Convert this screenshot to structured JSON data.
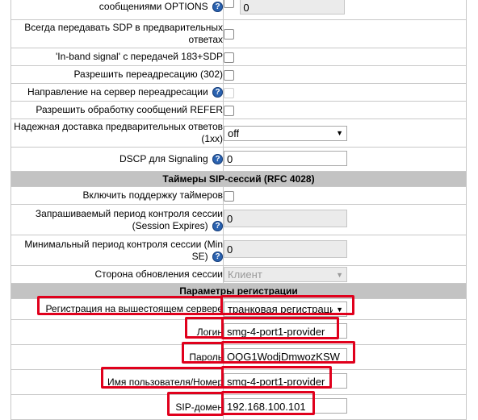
{
  "rows": {
    "options_label": "сообщениями OPTIONS",
    "options_value": "0",
    "sdp_label": "Всегда передавать SDP в предварительных ответах",
    "inband_label": "'In-band signal' с передачей 183+SDP",
    "redirect302_label": "Разрешить переадресацию (302)",
    "redirect_dir_label": "Направление на сервер переадресации",
    "refer_label": "Разрешить обработку сообщений REFER",
    "reliable_label": "Надежная доставка предварительных ответов (1xx)",
    "reliable_value": "off",
    "dscp_label": "DSCP для Signaling",
    "dscp_value": "0"
  },
  "timers": {
    "title": "Таймеры SIP-сессий (RFC 4028)",
    "enable_label": "Включить поддержку таймеров",
    "expires_label": "Запрашиваемый период контроля сессии (Session Expires)",
    "expires_value": "0",
    "min_label": "Минимальный период контроля сессии (Min SE)",
    "min_value": "0",
    "refresher_label": "Сторона обновления сессии",
    "refresher_value": "Клиент"
  },
  "registration": {
    "title": "Параметры регистрации",
    "upstream_label": "Регистрация на вышестоящем сервере",
    "upstream_value": "транковая регистраци",
    "login_label": "Логин",
    "login_value": "smg-4-port1-provider",
    "password_label": "Пароль",
    "password_value": "OQG1WodjDmwozKSW",
    "username_label": "Имя пользователя/Номер",
    "username_value": "smg-4-port1-provider",
    "domain_label": "SIP-домен",
    "domain_value": "192.168.100.101"
  },
  "icons": {
    "help": "help-icon",
    "dropdown": "chevron-down-icon"
  },
  "colors": {
    "highlight": "#e0001c",
    "section_bg": "#c3c3c3",
    "help_icon": "#2a62b0"
  }
}
